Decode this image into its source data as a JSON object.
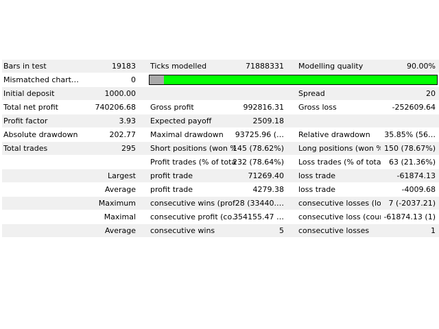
{
  "rows": [
    {
      "l1": "Bars in test",
      "v1": "19183",
      "l2": "Ticks modelled",
      "v2": "71888331",
      "l3": "Modelling quality",
      "v3": "90.00%",
      "shade": true
    },
    {
      "l1": "Mismatched chart…",
      "v1": "0",
      "bar": true,
      "shade": false
    },
    {
      "l1": "Initial deposit",
      "v1": "1000.00",
      "l2": "",
      "v2": "",
      "l3": "Spread",
      "v3": "20",
      "shade": true
    },
    {
      "l1": "Total net profit",
      "v1": "740206.68",
      "l2": "Gross profit",
      "v2": "992816.31",
      "l3": "Gross loss",
      "v3": "-252609.64",
      "shade": false
    },
    {
      "l1": "Profit factor",
      "v1": "3.93",
      "l2": "Expected payoff",
      "v2": "2509.18",
      "l3": "",
      "v3": "",
      "shade": true
    },
    {
      "l1": "Absolute drawdown",
      "v1": "202.77",
      "l2": "Maximal drawdown",
      "v2": "93725.96 (…",
      "l3": "Relative drawdown",
      "v3": "35.85% (56…",
      "shade": false
    },
    {
      "l1": "Total trades",
      "v1": "295",
      "l2": "Short positions (won %)",
      "v2": "145 (78.62%)",
      "l3": "Long positions (won %)",
      "v3": "150 (78.67%)",
      "shade": true
    },
    {
      "l1": "",
      "v1": "",
      "l2": "Profit trades (% of total)",
      "v2": "232 (78.64%)",
      "l3": "Loss trades (% of total)",
      "v3": "63 (21.36%)",
      "shade": false
    },
    {
      "l1": "",
      "v1": "Largest",
      "l2": "profit trade",
      "v2": "71269.40",
      "l3": "loss trade",
      "v3": "-61874.13",
      "shade": true
    },
    {
      "l1": "",
      "v1": "Average",
      "l2": "profit trade",
      "v2": "4279.38",
      "l3": "loss trade",
      "v3": "-4009.68",
      "shade": false
    },
    {
      "l1": "",
      "v1": "Maximum",
      "l2": "consecutive wins (prof…",
      "v2": "28 (33440.…",
      "l3": "consecutive losses (lo…",
      "v3": "7 (-2037.21)",
      "shade": true
    },
    {
      "l1": "",
      "v1": "Maximal",
      "l2": "consecutive profit (co…",
      "v2": "354155.47 …",
      "l3": "consecutive loss (coun…",
      "v3": "-61874.13 (1)",
      "shade": false
    },
    {
      "l1": "",
      "v1": "Average",
      "l2": "consecutive wins",
      "v2": "5",
      "l3": "consecutive losses",
      "v3": "1",
      "shade": true
    }
  ],
  "quality_bar": {
    "fill_fraction": 0.95,
    "fill_color": "#00ff00",
    "empty_color": "#a9a9a9"
  }
}
